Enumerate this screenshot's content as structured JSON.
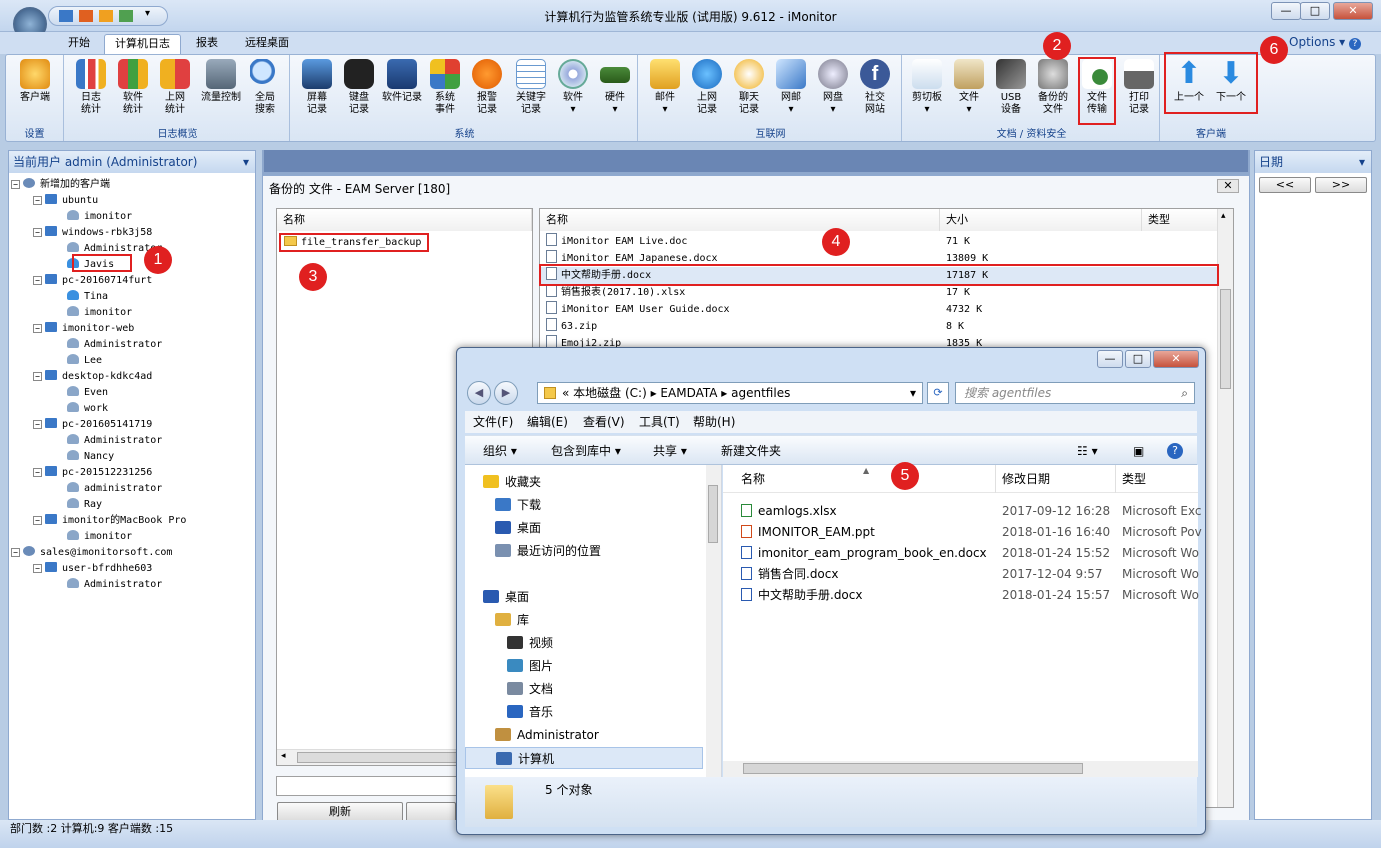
{
  "title": "计算机行为监管系统专业版 (试用版) 9.612 - iMonitor",
  "window_controls": {
    "minimize": "—",
    "maximize": "□",
    "close": "✕"
  },
  "ribbon_tabs": [
    {
      "label": "开始",
      "active": false
    },
    {
      "label": "计算机日志",
      "active": true
    },
    {
      "label": "报表",
      "active": false
    },
    {
      "label": "远程桌面",
      "active": false
    }
  ],
  "options_label": "Options",
  "ribbon": {
    "groups": [
      {
        "label": "设置",
        "buttons": [
          {
            "label": "客户端",
            "icon": "client-icon"
          }
        ]
      },
      {
        "label": "日志概览",
        "buttons": [
          {
            "label": "日志\n统计",
            "icon": "bar-chart-icon"
          },
          {
            "label": "软件\n统计",
            "icon": "software-stats-icon"
          },
          {
            "label": "上网\n统计",
            "icon": "web-stats-icon"
          },
          {
            "label": "流量控制",
            "icon": "traffic-icon"
          },
          {
            "label": "全局\n搜索",
            "icon": "search-icon"
          }
        ]
      },
      {
        "label": "系统",
        "buttons": [
          {
            "label": "屏幕\n记录",
            "icon": "screen-icon"
          },
          {
            "label": "键盘\n记录",
            "icon": "keyboard-icon"
          },
          {
            "label": "软件记录",
            "icon": "software-icon"
          },
          {
            "label": "系统\n事件",
            "icon": "windows-icon"
          },
          {
            "label": "报警\n记录",
            "icon": "alert-icon"
          },
          {
            "label": "关键字\n记录",
            "icon": "keyword-icon"
          },
          {
            "label": "软件",
            "icon": "cd-icon"
          },
          {
            "label": "硬件",
            "icon": "hardware-icon"
          }
        ]
      },
      {
        "label": "互联网",
        "buttons": [
          {
            "label": "邮件",
            "icon": "mail-icon"
          },
          {
            "label": "上网\n记录",
            "icon": "ie-icon"
          },
          {
            "label": "聊天\n记录",
            "icon": "chat-icon"
          },
          {
            "label": "网邮",
            "icon": "webmail-icon"
          },
          {
            "label": "网盘",
            "icon": "netdisk-icon"
          },
          {
            "label": "社交\n网站",
            "icon": "facebook-icon"
          }
        ]
      },
      {
        "label": "文档 / 资料安全",
        "buttons": [
          {
            "label": "剪切板",
            "icon": "clipboard-icon"
          },
          {
            "label": "文件",
            "icon": "file-icon"
          },
          {
            "label": "USB\n设备",
            "icon": "usb-icon"
          },
          {
            "label": "备份的\n文件",
            "icon": "backup-icon"
          },
          {
            "label": "文件\n传输",
            "icon": "file-transfer-icon"
          },
          {
            "label": "打印\n记录",
            "icon": "printer-icon"
          }
        ]
      },
      {
        "label": "客户端",
        "buttons": [
          {
            "label": "上一个",
            "icon": "arrow-up-icon"
          },
          {
            "label": "下一个",
            "icon": "arrow-down-icon"
          }
        ]
      }
    ]
  },
  "left_panel": {
    "header": "当前用户 admin (Administrator)",
    "tree": [
      {
        "label": "新增加的客户端",
        "level": 0,
        "type": "group"
      },
      {
        "label": "ubuntu",
        "level": 1,
        "type": "pc"
      },
      {
        "label": "imonitor",
        "level": 2,
        "type": "user"
      },
      {
        "label": "windows-rbk3j58",
        "level": 1,
        "type": "pc"
      },
      {
        "label": "Administrator",
        "level": 2,
        "type": "user"
      },
      {
        "label": "Javis",
        "level": 2,
        "type": "user-active"
      },
      {
        "label": "pc-20160714furt",
        "level": 1,
        "type": "pc"
      },
      {
        "label": "Tina",
        "level": 2,
        "type": "user-active"
      },
      {
        "label": "imonitor",
        "level": 2,
        "type": "user"
      },
      {
        "label": "imonitor-web",
        "level": 1,
        "type": "pc"
      },
      {
        "label": "Administrator",
        "level": 2,
        "type": "user"
      },
      {
        "label": "Lee",
        "level": 2,
        "type": "user"
      },
      {
        "label": "desktop-kdkc4ad",
        "level": 1,
        "type": "pc"
      },
      {
        "label": "Even",
        "level": 2,
        "type": "user"
      },
      {
        "label": "work",
        "level": 2,
        "type": "user"
      },
      {
        "label": "pc-201605141719",
        "level": 1,
        "type": "pc"
      },
      {
        "label": "Administrator",
        "level": 2,
        "type": "user"
      },
      {
        "label": "Nancy",
        "level": 2,
        "type": "user"
      },
      {
        "label": "pc-201512231256",
        "level": 1,
        "type": "pc"
      },
      {
        "label": "administrator",
        "level": 2,
        "type": "user"
      },
      {
        "label": "Ray",
        "level": 2,
        "type": "user"
      },
      {
        "label": "imonitor的MacBook Pro",
        "level": 1,
        "type": "pc"
      },
      {
        "label": "imonitor",
        "level": 2,
        "type": "user"
      },
      {
        "label": "sales@imonitorsoft.com",
        "level": 0,
        "type": "group"
      },
      {
        "label": "user-bfrdhhe603",
        "level": 1,
        "type": "pc"
      },
      {
        "label": "Administrator",
        "level": 2,
        "type": "user"
      }
    ]
  },
  "status_bar": "部门数 :2  计算机:9  客户端数 :15",
  "doc_window": {
    "title": "备份的 文件 - EAM Server [180]",
    "close": "✕",
    "left_header": "名称",
    "folder": "file_transfer_backup",
    "right_headers": {
      "name": "名称",
      "size": "大小",
      "type": "类型"
    },
    "files": [
      {
        "name": "iMonitor EAM Live.doc",
        "size": "71 K"
      },
      {
        "name": "iMonitor EAM Japanese.docx",
        "size": "13809 K"
      },
      {
        "name": "中文帮助手册.docx",
        "size": "17187 K"
      },
      {
        "name": "销售报表(2017.10).xlsx",
        "size": "17 K"
      },
      {
        "name": "iMonitor EAM User Guide.docx",
        "size": "4732 K"
      },
      {
        "name": "63.zip",
        "size": "8 K"
      },
      {
        "name": "Emoji2.zip",
        "size": "1835 K"
      }
    ],
    "refresh_button": "刷新"
  },
  "right_panel": {
    "header": "日期",
    "prev": "<<",
    "next": ">>"
  },
  "explorer": {
    "path": [
      "本地磁盘 (C:)",
      "EAMDATA",
      "agentfiles"
    ],
    "search_placeholder": "搜索 agentfiles",
    "menu": [
      "文件(F)",
      "编辑(E)",
      "查看(V)",
      "工具(T)",
      "帮助(H)"
    ],
    "toolbar": [
      "组织 ▾",
      "包含到库中 ▾",
      "共享 ▾",
      "新建文件夹"
    ],
    "nav": [
      {
        "label": "收藏夹",
        "indent": 0
      },
      {
        "label": "下载",
        "indent": 1
      },
      {
        "label": "桌面",
        "indent": 1
      },
      {
        "label": "最近访问的位置",
        "indent": 1
      },
      {
        "label": "桌面",
        "indent": 0
      },
      {
        "label": "库",
        "indent": 1
      },
      {
        "label": "视频",
        "indent": 2
      },
      {
        "label": "图片",
        "indent": 2
      },
      {
        "label": "文档",
        "indent": 2
      },
      {
        "label": "音乐",
        "indent": 2
      },
      {
        "label": "Administrator",
        "indent": 1
      },
      {
        "label": "计算机",
        "indent": 1
      }
    ],
    "columns": {
      "name": "名称",
      "date": "修改日期",
      "type": "类型"
    },
    "files": [
      {
        "name": "eamlogs.xlsx",
        "date": "2017-09-12 16:28",
        "type": "Microsoft Exc"
      },
      {
        "name": "IMONITOR_EAM.ppt",
        "date": "2018-01-16 16:40",
        "type": "Microsoft Pov"
      },
      {
        "name": "imonitor_eam_program_book_en.docx",
        "date": "2018-01-24 15:52",
        "type": "Microsoft Wo"
      },
      {
        "name": "销售合同.docx",
        "date": "2017-12-04 9:57",
        "type": "Microsoft Wo"
      },
      {
        "name": "中文帮助手册.docx",
        "date": "2018-01-24 15:57",
        "type": "Microsoft Wo"
      }
    ],
    "status": "5 个对象"
  },
  "callouts": [
    "1",
    "2",
    "3",
    "4",
    "5",
    "6"
  ],
  "colors": {
    "highlight": "#e02020",
    "ribbon_text": "#15428b"
  }
}
